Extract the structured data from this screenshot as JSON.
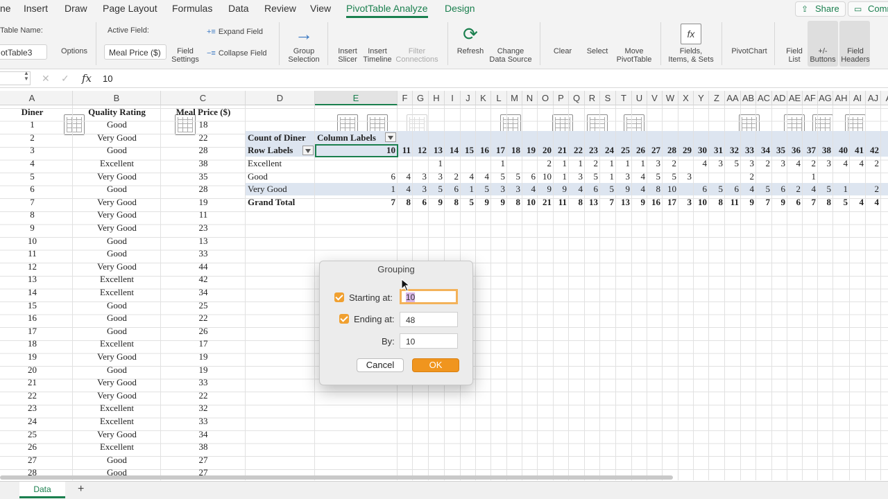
{
  "menu": {
    "tabs": [
      "ne",
      "Insert",
      "Draw",
      "Page Layout",
      "Formulas",
      "Data",
      "Review",
      "View",
      "PivotTable Analyze",
      "Design"
    ],
    "share": "Share",
    "comments": "Comm"
  },
  "ribbon": {
    "pivot_name_label": "Table Name:",
    "pivot_name_value": "otTable3",
    "options": "Options",
    "active_field_label": "Active Field:",
    "active_field_value": "Meal Price ($)",
    "field_settings": [
      "Field",
      "Settings"
    ],
    "expand_field": "Expand Field",
    "collapse_field": "Collapse Field",
    "group_selection": [
      "Group",
      "Selection"
    ],
    "insert_slicer": [
      "Insert",
      "Slicer"
    ],
    "insert_timeline": [
      "Insert",
      "Timeline"
    ],
    "filter_connections": [
      "Filter",
      "Connections"
    ],
    "refresh": "Refresh",
    "change_data_source": [
      "Change",
      "Data Source"
    ],
    "clear": "Clear",
    "select": "Select",
    "move_pivot": [
      "Move",
      "PivotTable"
    ],
    "fields_items": [
      "Fields,",
      "Items, & Sets"
    ],
    "pivotchart": "PivotChart",
    "field_list": [
      "Field",
      "List"
    ],
    "buttons": [
      "+/-",
      "Buttons"
    ],
    "field_headers": [
      "Field",
      "Headers"
    ]
  },
  "formula_bar": {
    "fx": "fx",
    "value": "10"
  },
  "columns": [
    "A",
    "B",
    "C",
    "D",
    "E",
    "F",
    "G",
    "H",
    "I",
    "J",
    "K",
    "L",
    "M",
    "N",
    "O",
    "P",
    "Q",
    "R",
    "S",
    "T",
    "U",
    "V",
    "W",
    "X",
    "Y",
    "Z",
    "AA",
    "AB",
    "AC",
    "AD",
    "AE",
    "AF",
    "AG",
    "AH",
    "AI",
    "AJ",
    "A"
  ],
  "table": {
    "headers": [
      "Diner",
      "Quality Rating",
      "Meal Price ($)"
    ],
    "rows": [
      [
        "1",
        "Good",
        "18"
      ],
      [
        "2",
        "Very Good",
        "22"
      ],
      [
        "3",
        "Good",
        "28"
      ],
      [
        "4",
        "Excellent",
        "38"
      ],
      [
        "5",
        "Very Good",
        "35"
      ],
      [
        "6",
        "Good",
        "28"
      ],
      [
        "7",
        "Very Good",
        "19"
      ],
      [
        "8",
        "Very Good",
        "11"
      ],
      [
        "9",
        "Very Good",
        "23"
      ],
      [
        "10",
        "Good",
        "13"
      ],
      [
        "11",
        "Good",
        "33"
      ],
      [
        "12",
        "Very Good",
        "44"
      ],
      [
        "13",
        "Excellent",
        "42"
      ],
      [
        "14",
        "Excellent",
        "34"
      ],
      [
        "15",
        "Good",
        "25"
      ],
      [
        "16",
        "Good",
        "22"
      ],
      [
        "17",
        "Good",
        "26"
      ],
      [
        "18",
        "Excellent",
        "17"
      ],
      [
        "19",
        "Very Good",
        "19"
      ],
      [
        "20",
        "Good",
        "19"
      ],
      [
        "21",
        "Very Good",
        "33"
      ],
      [
        "22",
        "Very Good",
        "22"
      ],
      [
        "23",
        "Excellent",
        "32"
      ],
      [
        "24",
        "Excellent",
        "33"
      ],
      [
        "25",
        "Very Good",
        "34"
      ],
      [
        "26",
        "Excellent",
        "38"
      ],
      [
        "27",
        "Good",
        "27"
      ],
      [
        "28",
        "Good",
        "27"
      ]
    ]
  },
  "pivot": {
    "count_label": "Count of Diner",
    "column_labels": "Column Labels",
    "row_labels": "Row Labels",
    "col_keys": [
      "10",
      "11",
      "12",
      "13",
      "14",
      "15",
      "16",
      "17",
      "18",
      "19",
      "20",
      "21",
      "22",
      "23",
      "24",
      "25",
      "26",
      "27",
      "28",
      "29",
      "30",
      "31",
      "32",
      "33",
      "34",
      "35",
      "36",
      "37",
      "38",
      "40",
      "41",
      "42"
    ],
    "rows": [
      {
        "label": "Excellent",
        "values": [
          "",
          "",
          "",
          "1",
          "",
          "",
          "",
          "1",
          "",
          "",
          "2",
          "1",
          "1",
          "2",
          "1",
          "1",
          "1",
          "3",
          "2",
          "",
          "4",
          "3",
          "5",
          "3",
          "2",
          "3",
          "4",
          "2",
          "3",
          "4",
          "4",
          "2"
        ]
      },
      {
        "label": "Good",
        "values": [
          "6",
          "4",
          "3",
          "3",
          "2",
          "4",
          "4",
          "5",
          "5",
          "6",
          "10",
          "1",
          "3",
          "5",
          "1",
          "3",
          "4",
          "5",
          "5",
          "3",
          "",
          "",
          "",
          "2",
          "",
          "",
          "",
          "1",
          "",
          "",
          "",
          ""
        ]
      },
      {
        "label": "Very Good",
        "values": [
          "1",
          "4",
          "3",
          "5",
          "6",
          "1",
          "5",
          "3",
          "3",
          "4",
          "9",
          "9",
          "4",
          "6",
          "5",
          "9",
          "4",
          "8",
          "10",
          "",
          "6",
          "5",
          "6",
          "4",
          "5",
          "6",
          "2",
          "4",
          "5",
          "1",
          "",
          "2"
        ]
      }
    ],
    "grand_total_label": "Grand Total",
    "grand_totals": [
      "7",
      "8",
      "6",
      "9",
      "8",
      "5",
      "9",
      "9",
      "8",
      "10",
      "21",
      "11",
      "8",
      "13",
      "7",
      "13",
      "9",
      "16",
      "17",
      "3",
      "10",
      "8",
      "11",
      "9",
      "7",
      "9",
      "6",
      "7",
      "8",
      "5",
      "4",
      "4"
    ]
  },
  "dialog": {
    "title": "Grouping",
    "starting_label": "Starting at:",
    "starting_value": "10",
    "ending_label": "Ending at:",
    "ending_value": "48",
    "by_label": "By:",
    "by_value": "10",
    "cancel": "Cancel",
    "ok": "OK"
  },
  "sheets": {
    "active": "Data",
    "add": "+"
  },
  "colors": {
    "accent": "#1a7f4e",
    "ok_button": "#f0951e",
    "pivot_band": "#dde5f0"
  }
}
